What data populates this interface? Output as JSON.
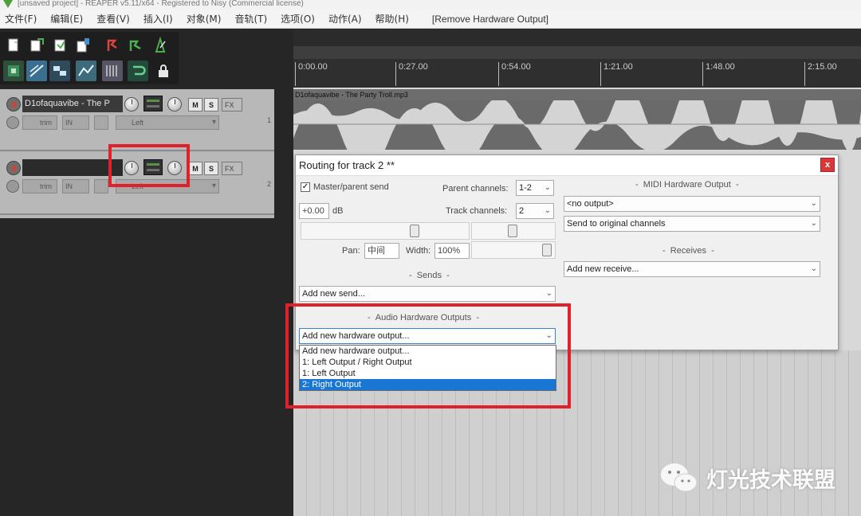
{
  "window": {
    "title": "[unsaved project] - REAPER v5.11/x64 - Registered to Nisy (Commercial license)"
  },
  "menu": {
    "items": [
      "文件(F)",
      "编辑(E)",
      "查看(V)",
      "插入(I)",
      "对象(M)",
      "音轨(T)",
      "选项(O)",
      "动作(A)",
      "帮助(H)"
    ],
    "action_title": "[Remove Hardware Output]"
  },
  "timeline": {
    "ticks": [
      "0:00.00",
      "0:27.00",
      "0:54.00",
      "1:21.00",
      "1:48.00",
      "2:15.00"
    ]
  },
  "media_item": {
    "label": "D1ofaquavibe - The Party Troll.mp3"
  },
  "tracks": [
    {
      "number": "1",
      "name": "D1ofaquavibe - The P",
      "mute": "M",
      "solo": "S",
      "fx": "FX",
      "trim": "trim",
      "input": "IN",
      "channel": "Left"
    },
    {
      "number": "2",
      "name": "",
      "mute": "M",
      "solo": "S",
      "fx": "FX",
      "trim": "trim",
      "input": "IN",
      "channel": "Left"
    }
  ],
  "routing": {
    "title": "Routing for track 2 **",
    "close": "x",
    "master_send_label": "Master/parent send",
    "master_send_checked": true,
    "check_mark": "✓",
    "volume": "+0.00",
    "volume_unit": "dB",
    "parent_channels_label": "Parent channels:",
    "parent_channels_value": "1-2",
    "track_channels_label": "Track channels:",
    "track_channels_value": "2",
    "pan_label": "Pan:",
    "pan_value": "中间",
    "width_label": "Width:",
    "width_value": "100%",
    "pan_level": 0.5,
    "sends_header": "Sends",
    "add_send": "Add new send...",
    "hw_outputs_header": "Audio Hardware Outputs",
    "add_hw_output": "Add new hardware output...",
    "hw_output_options": [
      "Add new hardware output...",
      "1: Left Output / Right Output",
      "1: Left Output",
      "2: Right Output"
    ],
    "hw_output_selected_index": 3,
    "midi_hw_header": "MIDI Hardware Output",
    "midi_output": "<no output>",
    "midi_channels": "Send to original channels",
    "receives_header": "Receives",
    "add_receive": "Add new receive..."
  },
  "watermark": {
    "text": "灯光技术联盟"
  },
  "colors": {
    "highlight": "#e0202a",
    "selected": "#1976d2",
    "close": "#d9383a"
  }
}
